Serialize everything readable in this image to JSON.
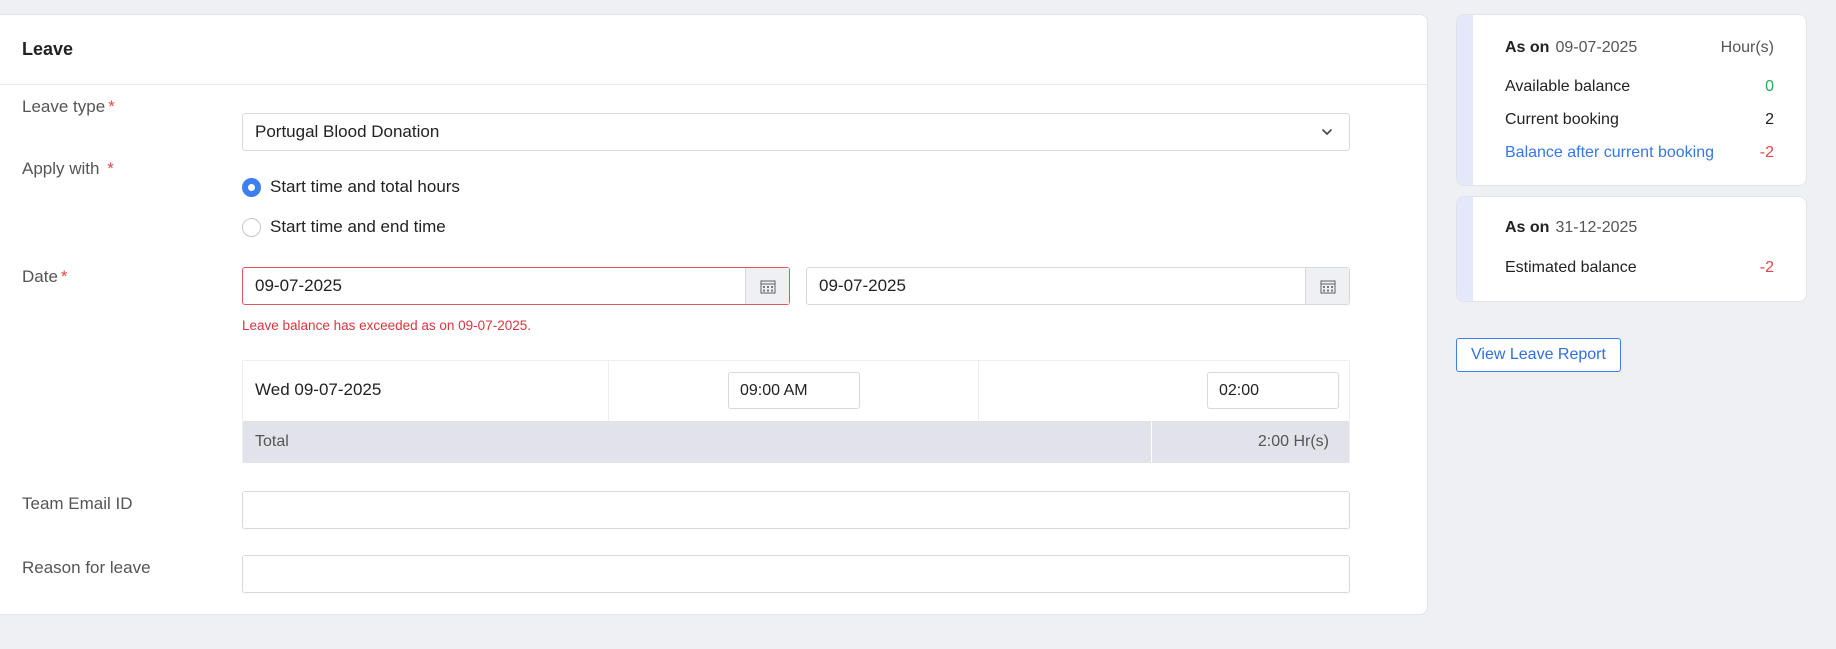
{
  "form": {
    "title": "Leave",
    "leave_type": {
      "label": "Leave type",
      "required_mark": "*",
      "value": "Portugal Blood Donation"
    },
    "apply_with": {
      "label": "Apply with",
      "required_mark": "*",
      "options": [
        {
          "label": "Start time and total hours",
          "selected": true
        },
        {
          "label": "Start time and end time",
          "selected": false
        }
      ]
    },
    "date": {
      "label": "Date",
      "required_mark": "*",
      "from": "09-07-2025",
      "to": "09-07-2025",
      "error": "Leave balance has exceeded as on 09-07-2025."
    },
    "days": [
      {
        "day": "Wed 09-07-2025",
        "start_time": "09:00 AM",
        "hours": "02:00"
      }
    ],
    "total": {
      "label": "Total",
      "value": "2:00 Hr(s)"
    },
    "team_email": {
      "label": "Team Email ID",
      "value": ""
    },
    "reason": {
      "label": "Reason for leave",
      "value": ""
    }
  },
  "balance_card": {
    "as_on_label": "As on",
    "as_on_date": "09-07-2025",
    "unit": "Hour(s)",
    "rows": [
      {
        "label": "Available balance",
        "value": "0"
      },
      {
        "label": "Current booking",
        "value": "2"
      },
      {
        "label": "Balance after current booking",
        "value": "-2"
      }
    ]
  },
  "estimated_card": {
    "as_on_label": "As on",
    "as_on_date": "31-12-2025",
    "label": "Estimated balance",
    "value": "-2"
  },
  "view_report_button": "View Leave Report",
  "colors": {
    "accent": "#3d7ff0",
    "error": "#e54747",
    "positive": "#2aa752"
  }
}
